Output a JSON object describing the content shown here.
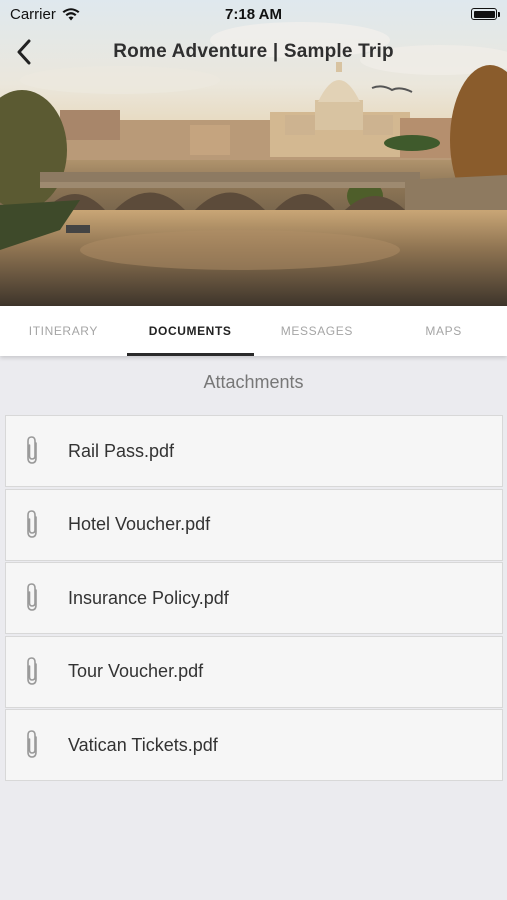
{
  "status_bar": {
    "carrier": "Carrier",
    "time": "7:18 AM",
    "icons": [
      "wifi-icon",
      "battery-icon"
    ]
  },
  "nav": {
    "title": "Rome Adventure | Sample Trip",
    "back_icon": "chevron-left-icon"
  },
  "hero": {
    "description_icon": "rome-photo"
  },
  "tabs": [
    {
      "label": "ITINERARY",
      "active": false
    },
    {
      "label": "DOCUMENTS",
      "active": true
    },
    {
      "label": "MESSAGES",
      "active": false
    },
    {
      "label": "MAPS",
      "active": false
    }
  ],
  "attachments": {
    "title": "Attachments",
    "icon": "paperclip-icon",
    "files": [
      {
        "name": "Rail Pass.pdf"
      },
      {
        "name": "Hotel Voucher.pdf"
      },
      {
        "name": "Insurance Policy.pdf"
      },
      {
        "name": "Tour Voucher.pdf"
      },
      {
        "name": "Vatican Tickets.pdf"
      }
    ]
  },
  "colors": {
    "background": "#ebebef",
    "tab_active": "#222222",
    "tab_inactive": "#a5a5a5",
    "row_bg": "#f6f6f6"
  }
}
